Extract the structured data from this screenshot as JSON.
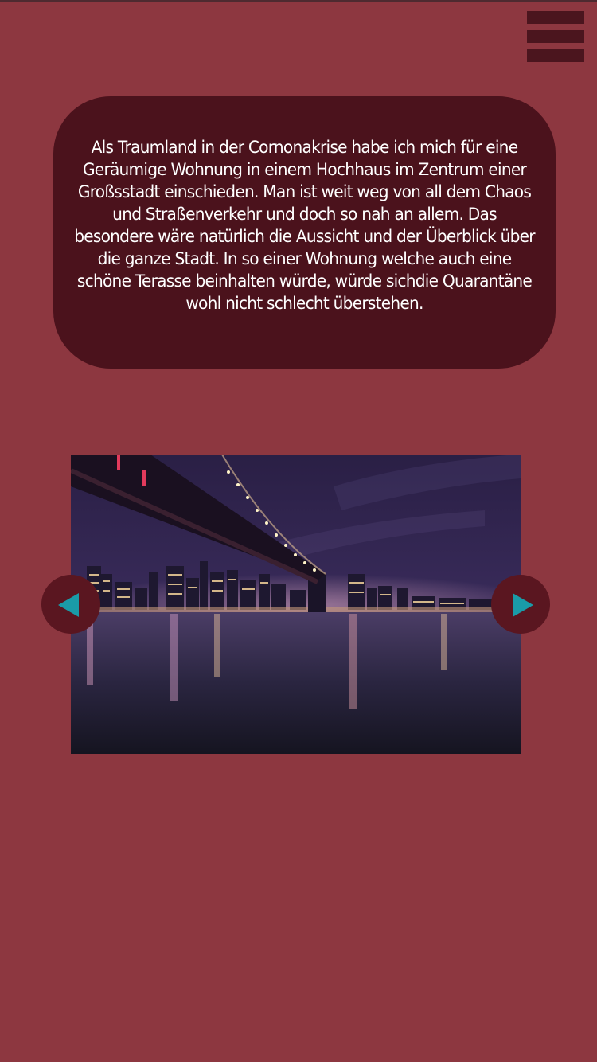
{
  "header": {
    "menu_icon": "hamburger-menu-icon"
  },
  "description": {
    "text": "Als Traumland in der Cornonakrise habe ich mich für eine Geräumige Wohnung in einem Hochhaus im Zentrum einer Großsstadt einschieden. Man ist weit weg von all dem Chaos und Straßenverkehr und doch so nah an allem. Das besondere wäre natürlich die Aussicht und der Überblick über die ganze Stadt. In so einer Wohnung welche auch eine schöne Terasse beinhalten würde, würde sichdie Quarantäne wohl nicht schlecht überstehen."
  },
  "carousel": {
    "prev_icon": "triangle-left-icon",
    "next_icon": "triangle-right-icon"
  },
  "colors": {
    "background": "#8d3740",
    "card": "#4b121c",
    "menu_bars": "#4b151e",
    "nav_button": "#5a1620",
    "nav_arrow": "#1a9ba8",
    "text": "#ffffff"
  }
}
